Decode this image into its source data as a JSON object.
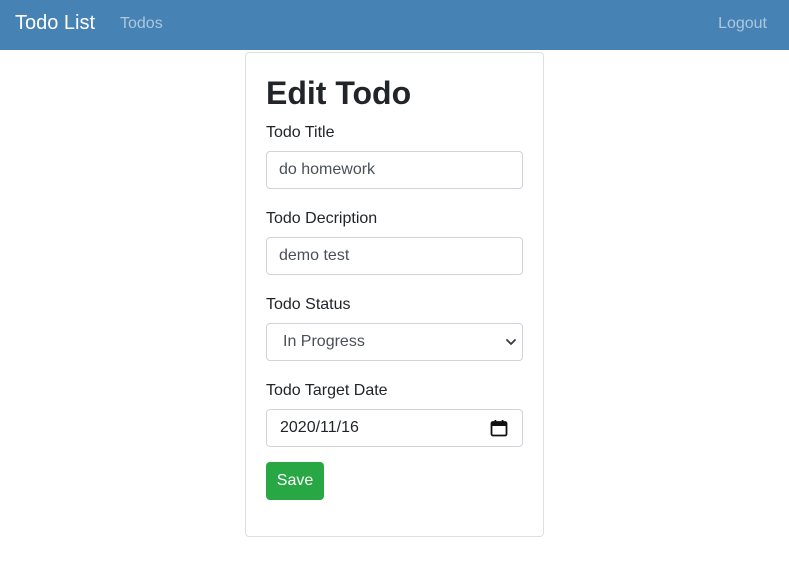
{
  "navbar": {
    "brand": "Todo List",
    "links": [
      {
        "label": "Todos"
      },
      {
        "label": "Logout"
      }
    ],
    "background_color": "#4682b4"
  },
  "form": {
    "heading": "Edit Todo",
    "title_label": "Todo Title",
    "title_value": "do homework",
    "description_label": "Todo Decription",
    "description_value": "demo test",
    "status_label": "Todo Status",
    "status_value": "In Progress",
    "target_date_label": "Todo Target Date",
    "target_date_value": "2020/11/16",
    "save_label": "Save",
    "save_color": "#28a745"
  },
  "icons": {
    "status_dropdown": "chevron-down-icon",
    "date_picker": "calendar-icon"
  }
}
